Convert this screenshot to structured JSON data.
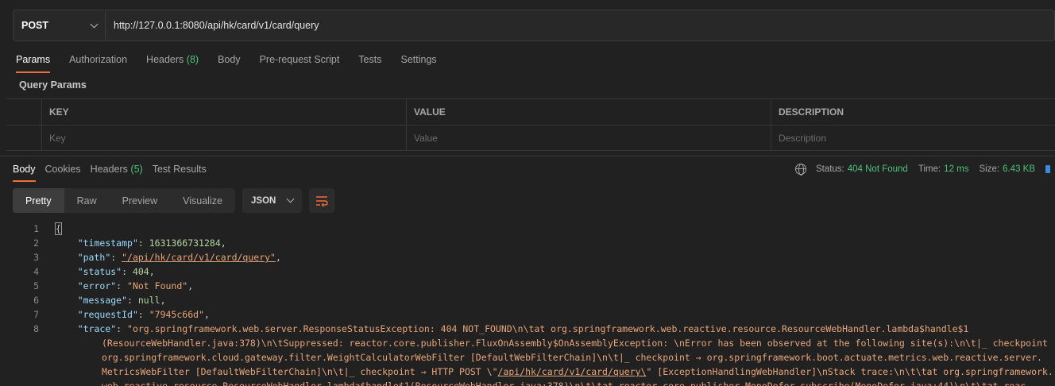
{
  "request": {
    "method": "POST",
    "url": "http://127.0.0.1:8080/api/hk/card/v1/card/query"
  },
  "request_tabs": [
    {
      "label": "Params",
      "count": ""
    },
    {
      "label": "Authorization",
      "count": ""
    },
    {
      "label": "Headers",
      "count": "(8)"
    },
    {
      "label": "Body",
      "count": ""
    },
    {
      "label": "Pre-request Script",
      "count": ""
    },
    {
      "label": "Tests",
      "count": ""
    },
    {
      "label": "Settings",
      "count": ""
    }
  ],
  "query_params": {
    "title": "Query Params",
    "headers": {
      "key": "KEY",
      "value": "VALUE",
      "description": "DESCRIPTION"
    },
    "placeholders": {
      "key": "Key",
      "value": "Value",
      "description": "Description"
    }
  },
  "response": {
    "tabs": [
      {
        "label": "Body",
        "count": ""
      },
      {
        "label": "Cookies",
        "count": ""
      },
      {
        "label": "Headers",
        "count": "(5)"
      },
      {
        "label": "Test Results",
        "count": ""
      }
    ],
    "status_label": "Status:",
    "status_value": "404 Not Found",
    "time_label": "Time:",
    "time_value": "12 ms",
    "size_label": "Size:",
    "size_value": "6.43 KB",
    "view_modes": [
      "Pretty",
      "Raw",
      "Preview",
      "Visualize"
    ],
    "format": "JSON"
  },
  "code_lines": {
    "l1": "{",
    "ts_key": "\"timestamp\"",
    "ts_val": "1631366731284",
    "path_key": "\"path\"",
    "path_val": "\"/api/hk/card/v1/card/query\"",
    "status_key": "\"status\"",
    "status_val": "404",
    "error_key": "\"error\"",
    "error_val": "\"Not Found\"",
    "message_key": "\"message\"",
    "message_val": "null",
    "rid_key": "\"requestId\"",
    "rid_val": "\"7945c66d\"",
    "trace_key": "\"trace\"",
    "trace_1": "\"org.springframework.web.server.ResponseStatusException: 404 NOT_FOUND\\n\\tat org.springframework.web.reactive.resource.ResourceWebHandler.lambda$handle$1",
    "trace_2": "(ResourceWebHandler.java:378)\\n\\tSuppressed: reactor.core.publisher.FluxOnAssembly$OnAssemblyException: \\nError has been observed at the following site(s):\\n\\t|_ checkpoint",
    "trace_3": "org.springframework.cloud.gateway.filter.WeightCalculatorWebFilter [DefaultWebFilterChain]\\n\\t|_ checkpoint → org.springframework.boot.actuate.metrics.web.reactive.server.",
    "trace_4a": "MetricsWebFilter [DefaultWebFilterChain]\\n\\t|_ checkpoint → HTTP POST \\\"",
    "trace_4b": "/api/hk/card/v1/card/query\\",
    "trace_4c": "\" [ExceptionHandlingWebHandler]\\nStack trace:\\n\\t\\tat org.springframework.",
    "trace_5": "web.reactive.resource.ResourceWebHandler.lambda$handle$1(ResourceWebHandler.java:378)\\n\\t\\tat reactor.core.publisher.MonoDefer.subscribe(MonoDefer.java:44)\\n\\t\\tat reac"
  },
  "colors": {
    "accent": "#f26b3a",
    "success": "#4ec27b",
    "json_key": "#9cdcfe",
    "json_string": "#e9a57a",
    "json_number": "#b5d6a0"
  }
}
